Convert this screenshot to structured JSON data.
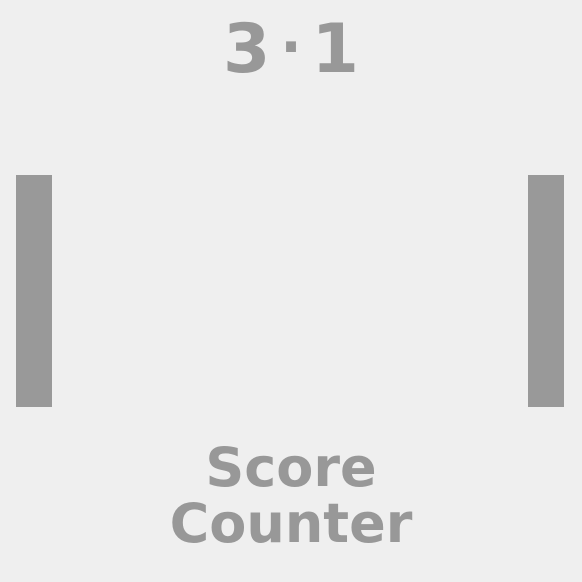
{
  "score": {
    "left": "3",
    "separator": "·",
    "right": "1"
  },
  "caption": {
    "line1": "Score",
    "line2": "Counter"
  },
  "colors": {
    "background": "#efefef",
    "foreground": "#989898",
    "paddle": "#999999"
  }
}
